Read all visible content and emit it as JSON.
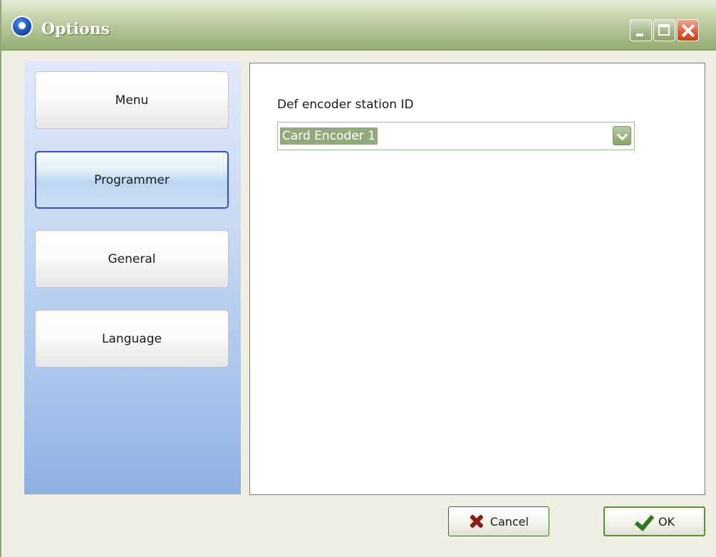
{
  "window": {
    "title": "Options",
    "controls": [
      "minimize",
      "maximize",
      "close"
    ]
  },
  "nav": {
    "items": [
      {
        "label": "Menu",
        "active": false
      },
      {
        "label": "Programmer",
        "active": true
      },
      {
        "label": "General",
        "active": false
      },
      {
        "label": "Language",
        "active": false
      }
    ]
  },
  "content": {
    "field_label": "Def encoder station ID",
    "combo_value": "Card Encoder 1"
  },
  "buttons": {
    "cancel_label": "Cancel",
    "ok_label": "OK"
  },
  "icons": {
    "app": "app-icon",
    "cancel": "x-icon",
    "ok": "check-icon",
    "dropdown": "chevron-down-icon"
  },
  "colors": {
    "titlebar": "#a9bd8a",
    "nav_gradient_bottom": "#8db0e2",
    "active_border": "#3a49d6",
    "selection": "#94a97b",
    "close_button": "#e1603a"
  }
}
